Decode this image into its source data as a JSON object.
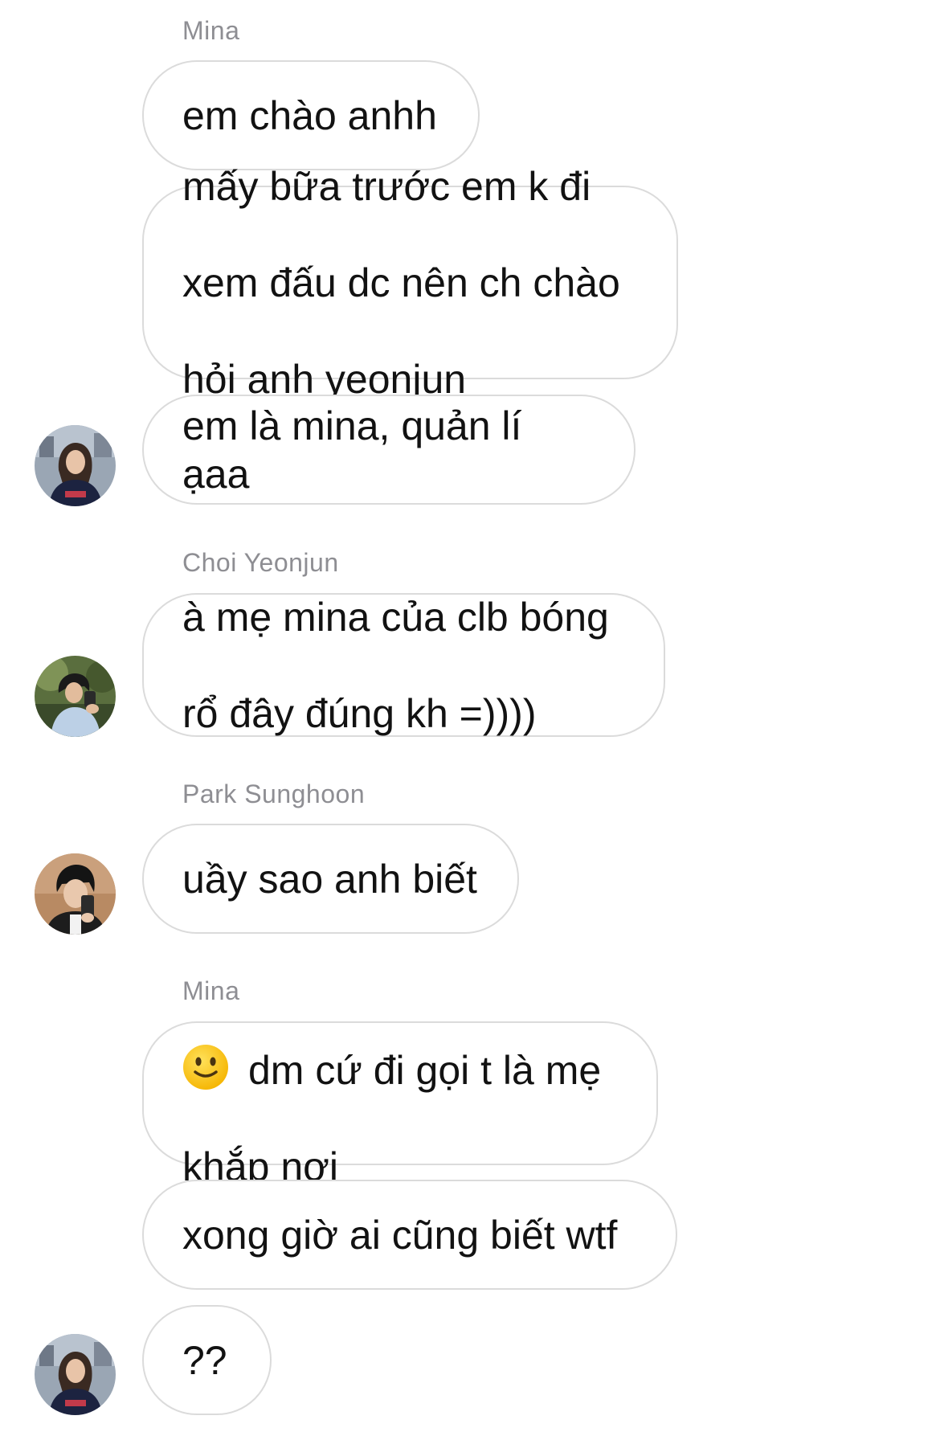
{
  "conversation": {
    "sender_labels": {
      "mina_1": "Mina",
      "choi": "Choi Yeonjun",
      "park": "Park Sunghoon",
      "mina_2": "Mina"
    },
    "messages": [
      {
        "sender": "Mina",
        "lines": [
          "em chào anhh"
        ]
      },
      {
        "sender": "Mina",
        "lines": [
          "mấy bữa trước em k đi",
          "xem đấu dc nên ch chào",
          "hỏi anh yeonjun"
        ]
      },
      {
        "sender": "Mina",
        "lines": [
          "em là mina, quản lí ạaa"
        ]
      },
      {
        "sender": "Choi Yeonjun",
        "lines": [
          "à mẹ mina của clb bóng",
          "rổ đây đúng kh =))))"
        ]
      },
      {
        "sender": "Park Sunghoon",
        "lines": [
          "uầy sao anh biết"
        ]
      },
      {
        "sender": "Mina",
        "emoji": "slightly-smiling-face-icon",
        "lines": [
          "dm cứ đi gọi t là mẹ",
          "khắp nơi"
        ]
      },
      {
        "sender": "Mina",
        "lines": [
          "xong giờ ai cũng biết wtf"
        ]
      },
      {
        "sender": "Mina",
        "lines": [
          "??"
        ]
      }
    ]
  },
  "avatars": {
    "mina": {
      "icon": "avatar-mina",
      "colors": {
        "bg": "#9aa6b4",
        "hair": "#3a2a22",
        "skin": "#e8c4a8",
        "hoodie": "#1c2340",
        "accent": "#c23a4a"
      }
    },
    "choi": {
      "icon": "avatar-choi-yeonjun",
      "colors": {
        "bg": "#5a6e3e",
        "hair": "#1a1a1a",
        "skin": "#e2bc9c",
        "shirt": "#bcd0e6"
      }
    },
    "park": {
      "icon": "avatar-park-sunghoon",
      "colors": {
        "bg": "#b88a63",
        "hair": "#141414",
        "skin": "#e9c8ad",
        "jacket": "#1d1d1d"
      }
    }
  }
}
